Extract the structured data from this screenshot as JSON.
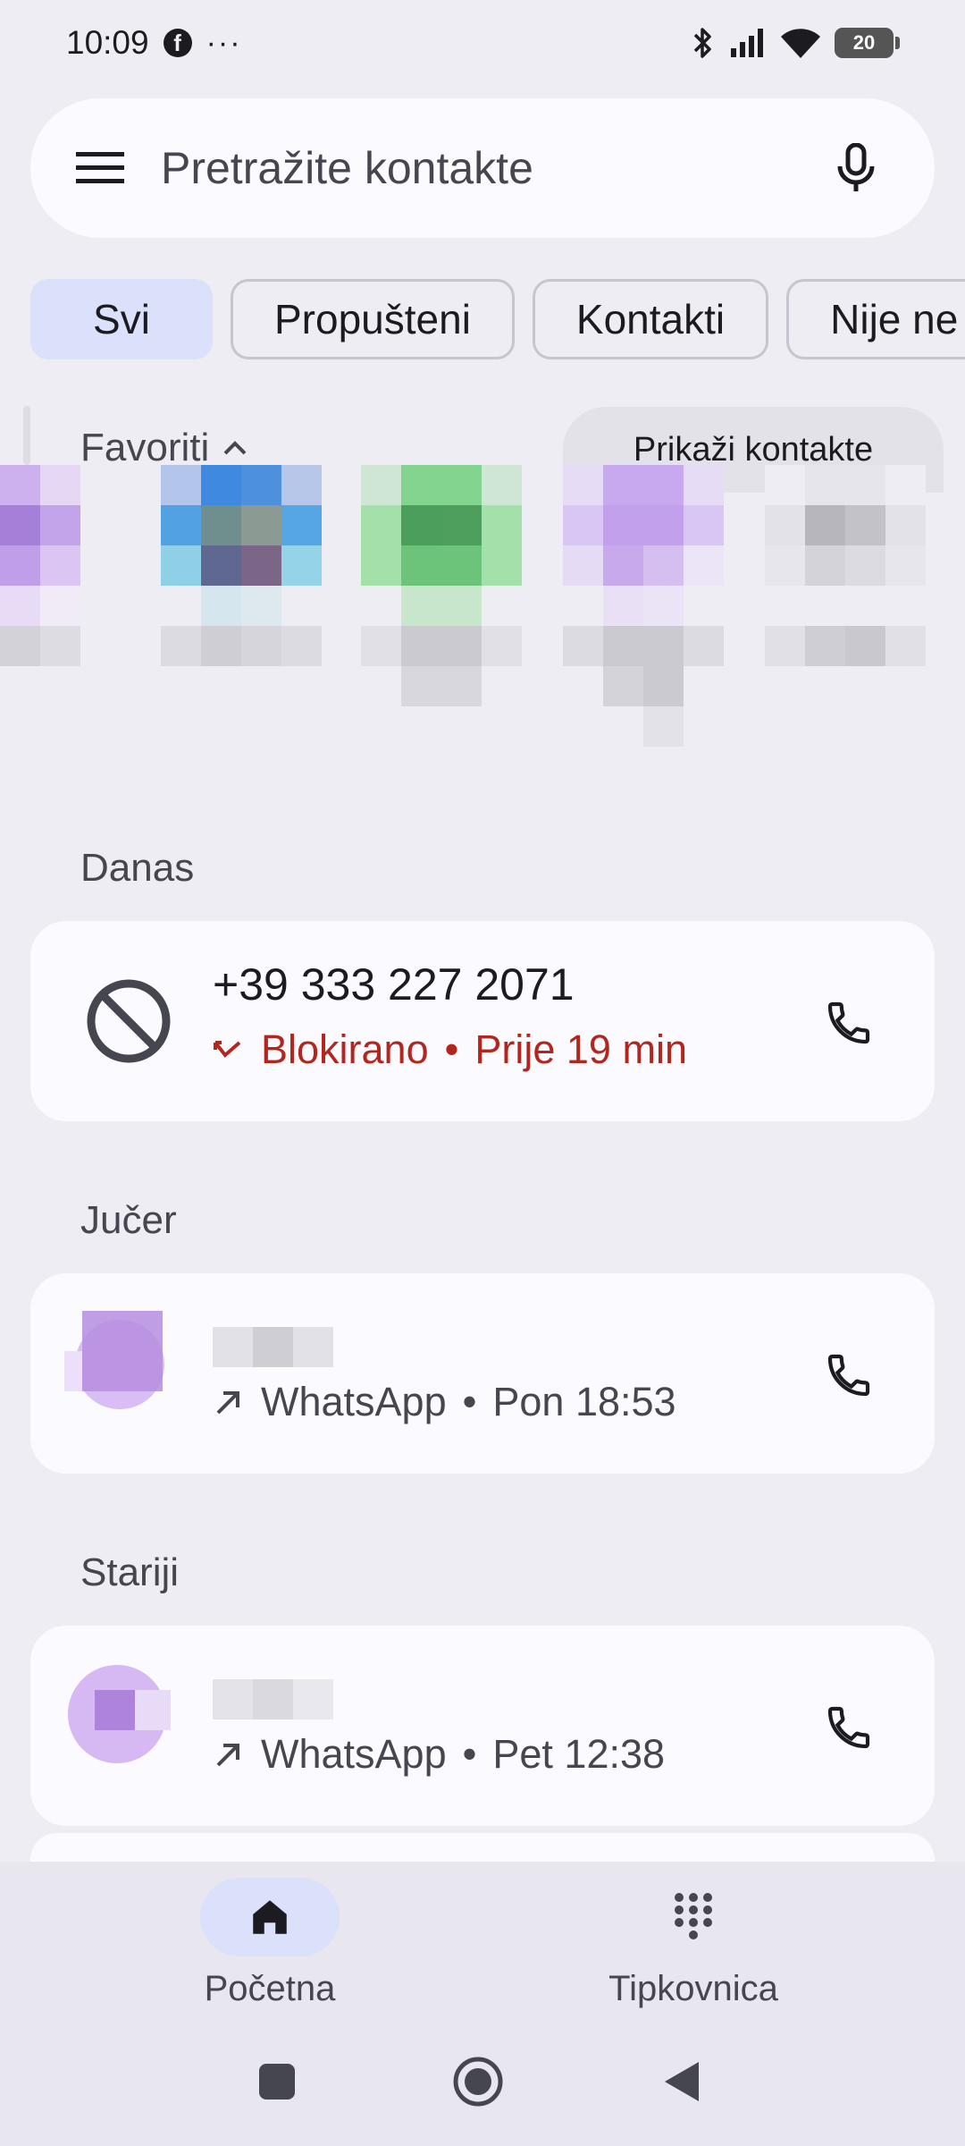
{
  "status_bar": {
    "time": "10:09",
    "notification_icons": [
      "facebook-icon",
      "more-dots"
    ],
    "dots": "···",
    "battery_level": "20"
  },
  "search": {
    "placeholder": "Pretražite kontakte"
  },
  "filters": {
    "chips": [
      {
        "label": "Svi",
        "selected": true
      },
      {
        "label": "Propušteni",
        "selected": false
      },
      {
        "label": "Kontakti",
        "selected": false
      },
      {
        "label": "Nije ne",
        "selected": false
      }
    ]
  },
  "favorites": {
    "title": "Favoriti",
    "show_contacts_label": "Prikaži kontakte"
  },
  "sections": {
    "today": "Danas",
    "yesterday": "Jučer",
    "older": "Stariji"
  },
  "calls": [
    {
      "name": "+39 333 227 2071",
      "status": "Blokirano",
      "time": "Prije 19 min",
      "separator": "•",
      "type": "blocked"
    },
    {
      "name": "",
      "status": "WhatsApp",
      "time": "Pon 18:53",
      "separator": "•",
      "type": "outgoing"
    },
    {
      "name": "",
      "status": "WhatsApp",
      "time": "Pet 12:38",
      "separator": "•",
      "type": "outgoing"
    }
  ],
  "bottom_nav": {
    "home_label": "Početna",
    "keypad_label": "Tipkovnica"
  },
  "colors": {
    "background": "#efedf4",
    "card": "#fbfaff",
    "accent_chip": "#dbe1fa",
    "blocked_red": "#b3261e"
  }
}
